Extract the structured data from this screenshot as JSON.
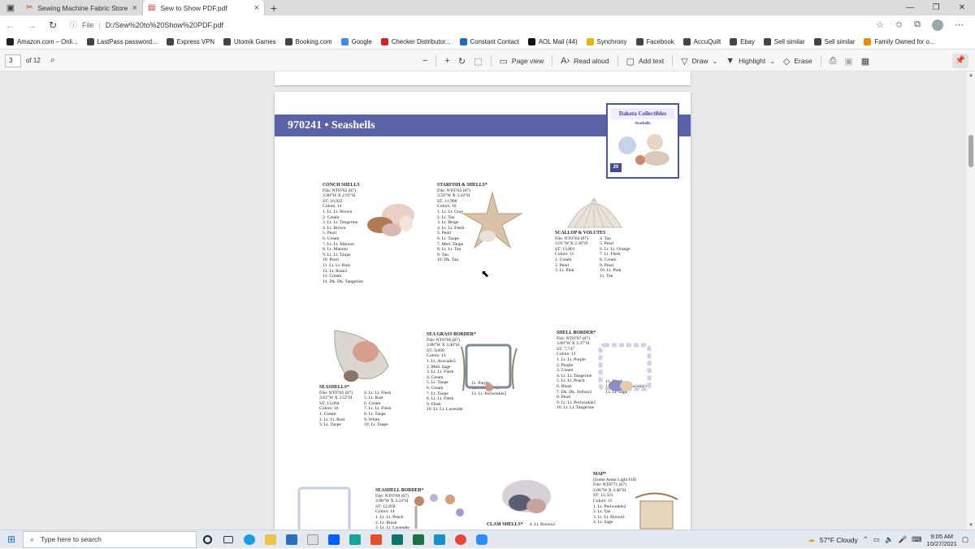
{
  "browser": {
    "tabs": [
      {
        "title": "Sewing Machine Fabric Store W",
        "active": false
      },
      {
        "title": "Sew to Show PDF.pdf",
        "active": true
      }
    ],
    "url_prefix": "File",
    "url": "D:/Sew%20to%20Show%20PDF.pdf",
    "favorites": [
      {
        "label": "Amazon.com – Onli...",
        "color": "#222222"
      },
      {
        "label": "LastPass password...",
        "color": "#444444"
      },
      {
        "label": "Express VPN",
        "color": "#444444"
      },
      {
        "label": "Utomik Games",
        "color": "#444444"
      },
      {
        "label": "Booking.com",
        "color": "#444444"
      },
      {
        "label": "Google",
        "color": "#4285f4"
      },
      {
        "label": "Checker Distributor...",
        "color": "#d22222"
      },
      {
        "label": "Constant Contact",
        "color": "#1d6fb8"
      },
      {
        "label": "AOL Mail (44)",
        "color": "#111111"
      },
      {
        "label": "Synchrony",
        "color": "#e6b800"
      },
      {
        "label": "Facebook",
        "color": "#444444"
      },
      {
        "label": "AccuQuilt",
        "color": "#444444"
      },
      {
        "label": "Ebay",
        "color": "#444444"
      },
      {
        "label": "Sell similar",
        "color": "#444444"
      },
      {
        "label": "Sell similar",
        "color": "#444444"
      },
      {
        "label": "Family Owned for o...",
        "color": "#f08a00"
      }
    ]
  },
  "pdf_toolbar": {
    "page_current": "3",
    "page_total": "of 12",
    "page_view": "Page view",
    "read_aloud": "Read aloud",
    "add_text": "Add text",
    "draw": "Draw",
    "highlight": "Highlight",
    "erase": "Erase"
  },
  "document": {
    "section_title": "970241 • Seashells",
    "cover": {
      "brand": "Dakota Collectibles",
      "title": "Seashells",
      "badge": "20"
    },
    "designs": [
      {
        "name": "CONCH SHELLS",
        "lines": [
          "File: NT0762 (07)",
          "3.90\"W X 2.91\"H",
          "ST: 16,922",
          "Colors: 14",
          "1. Lt. Lt. Brown",
          "2. Cream",
          "3. Lt. Lt. Tangerine",
          "4. Lt. Brown",
          "5. Pearl",
          "6. Cream",
          "7. Lt. Lt. Maroon",
          "8. Lt. Maroon",
          "9. Lt. Lt. Taupe",
          "10. Pearl",
          "11. Lt. Lt. Rust",
          "12. Lt. Rose2",
          "13. Cream",
          "14. Dk. Dk. Tangerine"
        ]
      },
      {
        "name": "STARFISH & SHELLS*",
        "lines": [
          "File: NT0763 (07)",
          "3.59\"W X 3.44\"H",
          "ST: 11,998",
          "Colors: 10",
          "1. Lt. Lt. Gray",
          "2. Lt. Tan",
          "3. Lt. Beige",
          "4. Lt. Lt. Flesh",
          "5. Pearl",
          "6. Lt. Taupe",
          "7. Med. Taupe",
          "8. Lt. Lt. Tan",
          "9. Tan",
          "10. Dk. Tan"
        ]
      },
      {
        "name": "SCALLOP & VOLUTES",
        "lines": [
          "File: NT0764 (07)",
          "3.91\"W X 2.30\"H",
          "ST: 13,801",
          "Colors: 11",
          "1. Cream",
          "2. Pearl",
          "3. Lt. Pink"
        ],
        "lines2": [
          "4. Tan",
          "5. Pearl",
          "6. Lt. Lt. Orange",
          "7. Lt. Flesh",
          "8. Cream",
          "9. Pearl",
          "10. Lt. Pink",
          "11. Tan"
        ]
      },
      {
        "name": "SEASHELLS*",
        "lines": [
          "File: NT0765 (07)",
          "3.62\"W X 3.52\"H",
          "ST: 13,664",
          "Colors: 10",
          "1. Cream",
          "2. Lt. Lt. Rust",
          "3. Lt. Taupe"
        ],
        "lines2": [
          "4. Lt. Lt. Flesh",
          "5. Lt. Rust",
          "6. Cream",
          "7. Lt. Lt. Flesh",
          "8. Lt. Taupe",
          "9. White",
          "10. Lt. Taupe"
        ]
      },
      {
        "name": "SEA GRASS BORDER*",
        "lines": [
          "File: NT0766 (07)",
          "3.88\"W X 3.40\"H",
          "ST: 9,668",
          "Colors: 13",
          "1. Lt. Avocado3",
          "2. Med. Sage",
          "3. Lt. Lt. Flesh",
          "4. Cream",
          "5. Lt. Taupe",
          "6. Cream",
          "7. Lt. Taupe",
          "8. Lt. Lt. Flesh",
          "9. Flesh",
          "10. Lt. Lt. Lavender"
        ],
        "lines2": [
          "11. Purple",
          "12. Med. Silver",
          "13. Lt. Periwinkle2"
        ]
      },
      {
        "name": "SHELL BORDER*",
        "lines": [
          "File: NT0767 (07)",
          "3.89\"W X 3.37\"H",
          "ST: 7,747",
          "Colors: 13",
          "1. Lt. Lt. Purple",
          "2. Purple",
          "3. Cream",
          "4. Lt. Lt. Tangerine",
          "5. Lt. Lt. Peach",
          "6. Blush",
          "7. Dk. Dk. Yellow2",
          "8. Pearl",
          "9. Lt. Lt. Periwinkle2",
          "10. Lt. Lt. Tangerine"
        ],
        "lines2": [
          "11. Blush",
          "12. Lt. Lt. Periwinkle2",
          "13. Lt. Sage"
        ]
      },
      {
        "name": "SEASHELL BORDER*",
        "lines": [
          "File: NT0769 (07)",
          "3.88\"W X 3.24\"H",
          "ST: 12,858",
          "Colors: 14",
          "1. Lt. Lt. Peach",
          "2. Lt. Blush",
          "3. Lt. Lt. Lavender"
        ]
      },
      {
        "name": "CLAM SHELLS*",
        "lines": [],
        "lines2": [
          "4. Lt. Brown2"
        ]
      },
      {
        "name": "MAP*",
        "lines": [
          "(Some Areas Light Fill)",
          "File: NT0771 (07)",
          "3.06\"W X 3.46\"H",
          "ST: 12,321",
          "Colors: 15",
          "1. Lt. Periwinkle2",
          "2. Lt. Tan",
          "3. Lt. Lt. Brown1",
          "4. Lt. Sage"
        ]
      }
    ]
  },
  "taskbar": {
    "search_placeholder": "Type here to search",
    "weather": "57°F  Cloudy",
    "time": "9:05 AM",
    "date": "10/27/2021"
  }
}
